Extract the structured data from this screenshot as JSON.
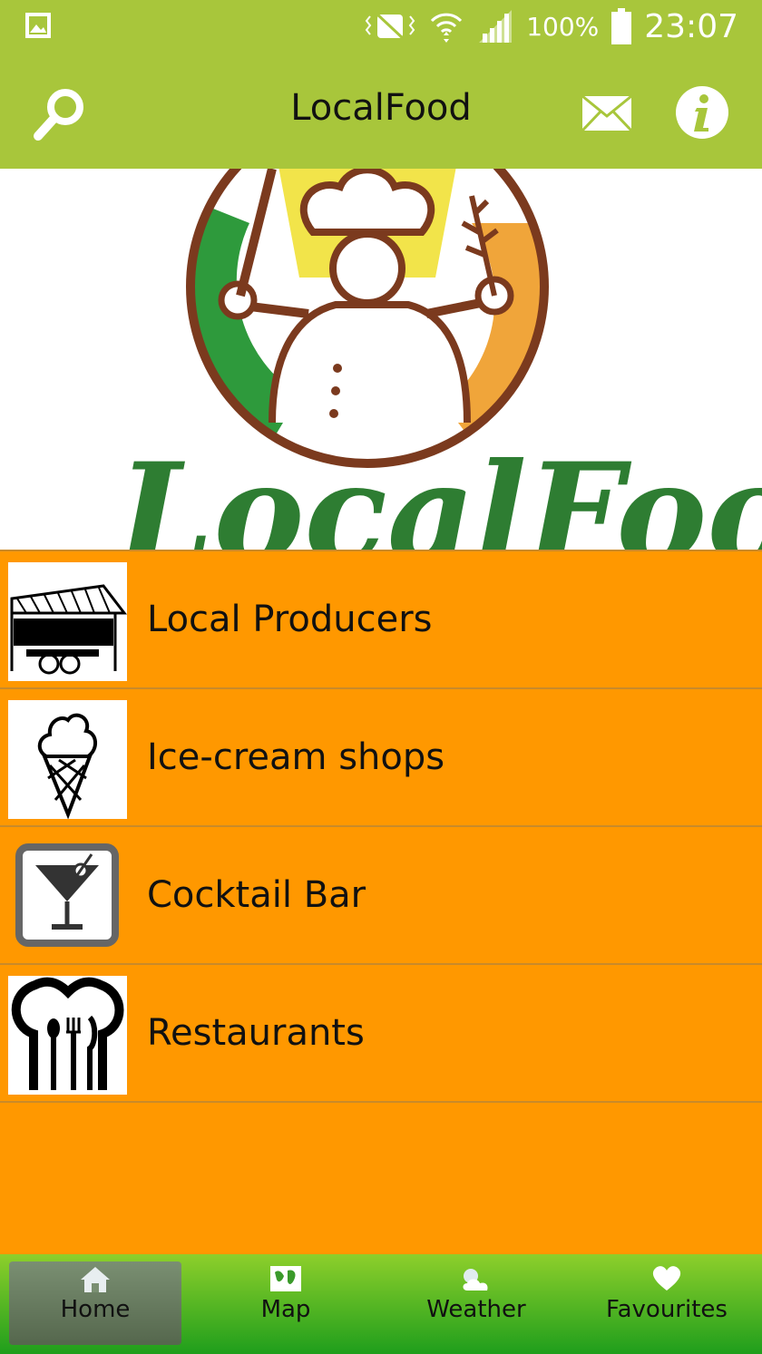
{
  "status_bar": {
    "battery_percent": "100%",
    "time": "23:07"
  },
  "app_bar": {
    "title": "LocalFood",
    "search_icon": "search-icon",
    "mail_icon": "mail-icon",
    "info_icon": "info-icon"
  },
  "banner": {
    "logo_text": "LocalFood"
  },
  "categories": [
    {
      "label": "Local Producers",
      "icon": "market-stall-icon"
    },
    {
      "label": "Ice-cream shops",
      "icon": "ice-cream-icon"
    },
    {
      "label": "Cocktail Bar",
      "icon": "cocktail-icon"
    },
    {
      "label": "Restaurants",
      "icon": "restaurant-icon"
    }
  ],
  "bottom_nav": [
    {
      "label": "Home",
      "icon": "home-icon",
      "active": true
    },
    {
      "label": "Map",
      "icon": "map-icon",
      "active": false
    },
    {
      "label": "Weather",
      "icon": "weather-icon",
      "active": false
    },
    {
      "label": "Favourites",
      "icon": "heart-icon",
      "active": false
    }
  ],
  "colors": {
    "header": "#a8c63b",
    "list_background": "#ff9800",
    "nav_gradient_top": "#8ecf2b",
    "nav_gradient_bottom": "#1f9e1c"
  }
}
